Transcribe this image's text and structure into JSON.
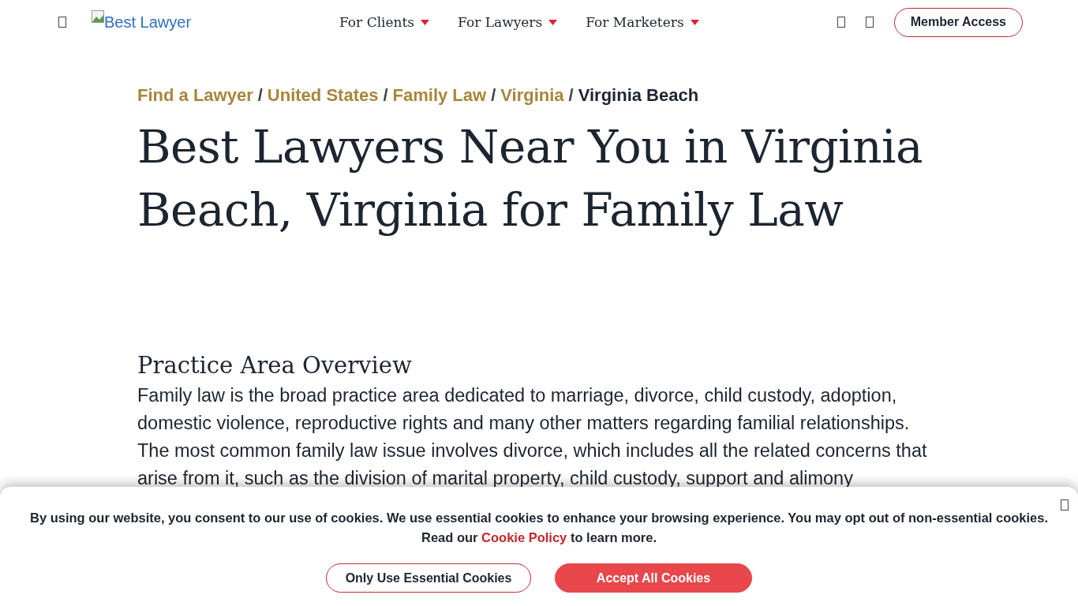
{
  "header": {
    "logo_alt": "Best Lawyer",
    "nav": [
      {
        "label": "For Clients"
      },
      {
        "label": "For Lawyers"
      },
      {
        "label": "For Marketers"
      }
    ],
    "member_button": "Member Access"
  },
  "breadcrumb": [
    {
      "label": "Find a Lawyer",
      "kind": "link"
    },
    {
      "separator": "/",
      "label": "United States",
      "kind": "link"
    },
    {
      "separator": "/",
      "label": "Family Law",
      "kind": "link"
    },
    {
      "separator": "/",
      "label": "Virginia",
      "kind": "link"
    },
    {
      "separator": "/",
      "label": "Virginia Beach",
      "kind": "current"
    }
  ],
  "title": "Best Lawyers Near You in Virginia Beach, Virginia for Family Law",
  "overview": {
    "heading": "Practice Area Overview",
    "text": "Family law is the broad practice area dedicated to marriage, divorce, child custody, adoption, domestic violence, reproductive rights and many other matters regarding familial relationships. The most common family law issue involves divorce, which includes all the related concerns that arise from it, such as the division of marital property, child custody, support and alimony"
  },
  "cookie_banner": {
    "text": "By using our website, you consent to our use of cookies. We use essential cookies to enhance your browsing experience. You may opt out of non-essential cookies.",
    "read_prefix": "Read our",
    "link": "Cookie Policy",
    "read_suffix": "to learn more.",
    "buttons": [
      {
        "label": "Only Use Essential Cookies",
        "kind": "secondary"
      },
      {
        "label": "Accept All Cookies",
        "kind": "primary"
      }
    ]
  }
}
